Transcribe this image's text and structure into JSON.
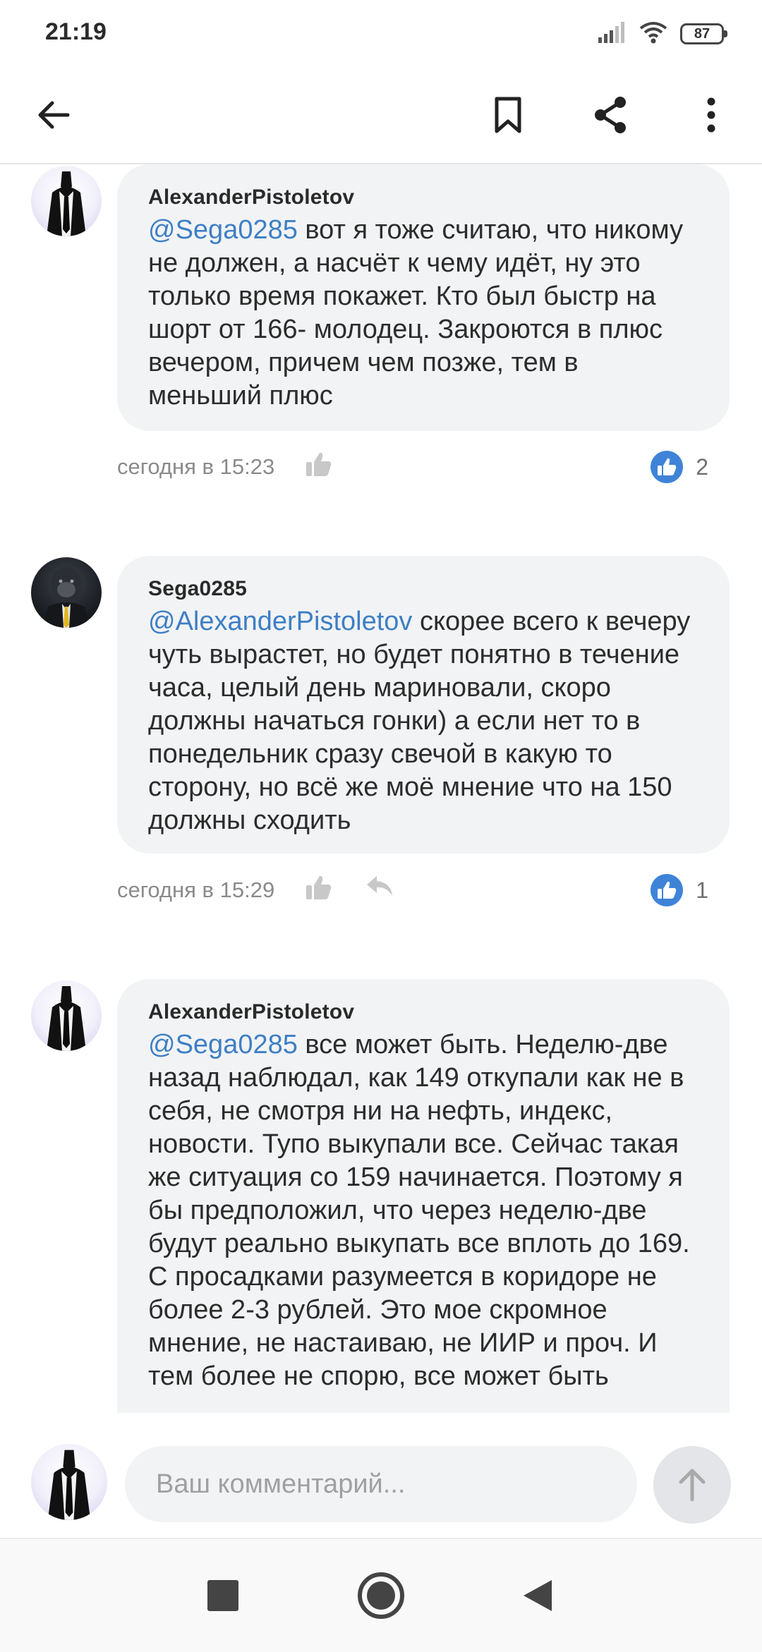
{
  "status_bar": {
    "time": "21:19",
    "battery": "87"
  },
  "app_bar": {
    "back_icon": "arrow-left-icon",
    "bookmark_icon": "bookmark-icon",
    "share_icon": "share-icon",
    "more_icon": "more-vertical-icon"
  },
  "comments": [
    {
      "author": "AlexanderPistoletov",
      "mention": "@Sega0285",
      "text": " вот я тоже считаю, что никому не должен, а насчёт к чему идёт, ну это только время покажет. Кто был быстр на шорт от 166- молодец. Закроются в плюс вечером, причем чем позже, тем в меньший плюс",
      "time": "сегодня в 15:23",
      "likes": "2",
      "avatar": "suit-avatar"
    },
    {
      "author": "Sega0285",
      "mention": "@AlexanderPistoletov",
      "text": " скорее всего к вечеру чуть вырастет, но будет понятно в течение часа, целый день мариновали, скоро должны начаться гонки) а если нет то в понедельник сразу свечой в какую то сторону, но всё же моё мнение что на 150 должны сходить",
      "time": "сегодня в 15:29",
      "likes": "1",
      "avatar": "gorilla-avatar"
    },
    {
      "author": "AlexanderPistoletov",
      "mention": "@Sega0285",
      "text": " все может быть. Неделю-две назад наблюдал, как 149 откупали как не в себя, не смотря ни на нефть, индекс, новости. Тупо выкупали все. Сейчас такая же ситуация со 159 начинается. Поэтому я бы предположил, что через неделю-две будут реально выкупать все вплоть до 169. С просадками разумеется в коридоре не более 2-3 рублей. Это мое скромное мнение, не настаиваю, не ИИР и проч. И тем более не спорю, все может быть",
      "avatar": "suit-avatar"
    }
  ],
  "composer": {
    "placeholder": "Ваш комментарий..."
  },
  "nav_bar": {
    "recents_icon": "square-icon",
    "home_icon": "circle-icon",
    "back_icon": "triangle-back-icon"
  }
}
